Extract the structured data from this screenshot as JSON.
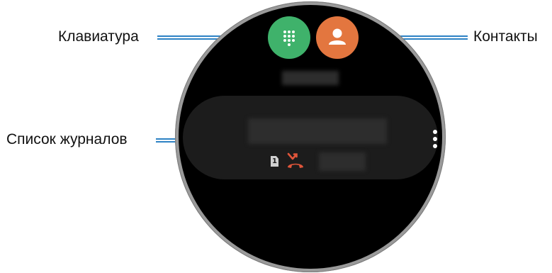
{
  "labels": {
    "keypad": "Клавиатура",
    "contacts": "Контакты",
    "logs": "Список журналов"
  },
  "call_log": {
    "sim_slot": "1"
  },
  "icons": {
    "keypad": "dialpad-icon",
    "contacts": "person-icon",
    "sim": "sim-card-icon",
    "missed_call": "missed-call-icon",
    "more": "more-vertical-icon"
  },
  "colors": {
    "keypad_button": "#3fb26b",
    "contacts_button": "#e3763f",
    "missed_call": "#e0553a",
    "callout_line": "#2d82c4"
  }
}
